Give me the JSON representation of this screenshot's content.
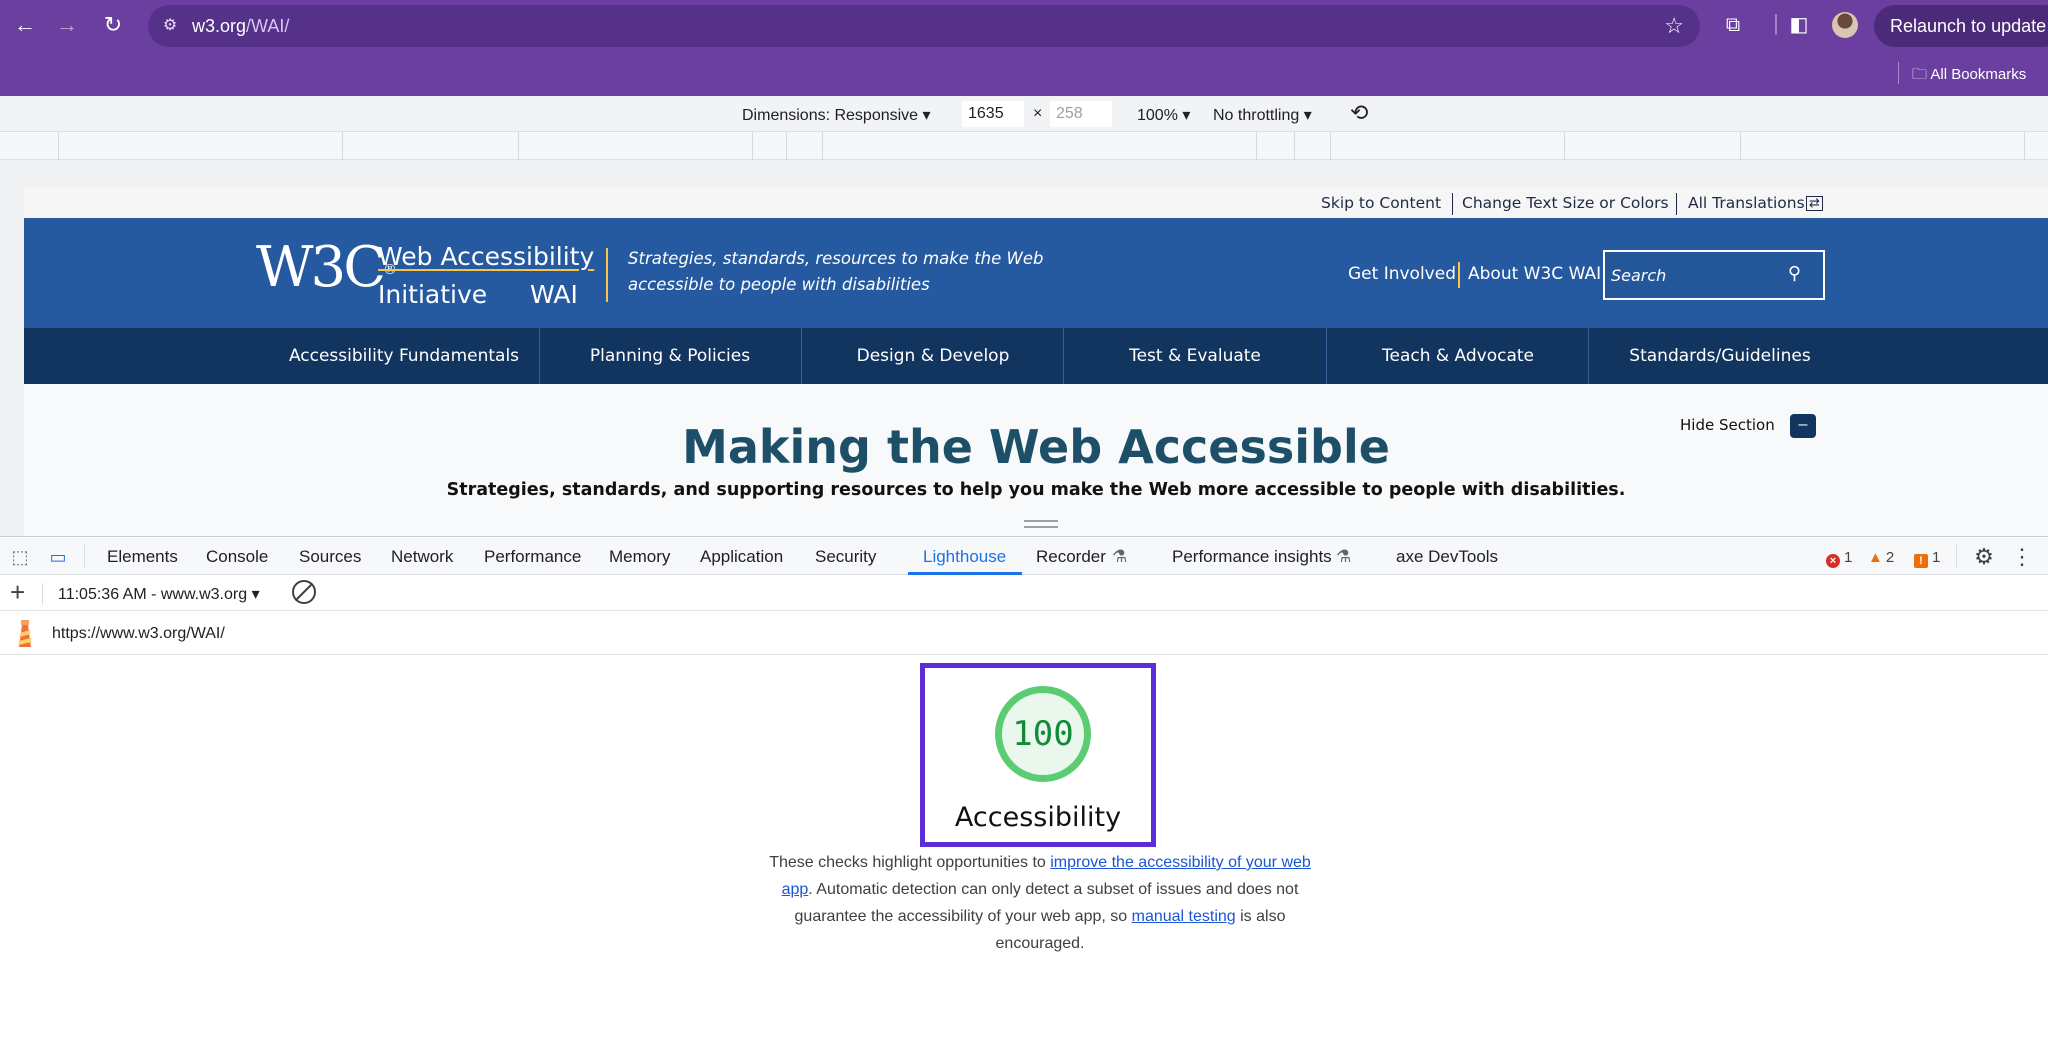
{
  "browser": {
    "url_host": "w3.org",
    "url_path": "/WAI/",
    "relaunch_label": "Relaunch to update",
    "bookmarks_label": "All Bookmarks"
  },
  "device_toolbar": {
    "dimensions_label": "Dimensions: Responsive ▾",
    "width_value": "1635",
    "times": "×",
    "height_placeholder": "258",
    "zoom": "100% ▾",
    "throttling": "No throttling ▾"
  },
  "w3c_page": {
    "skip_links": [
      "Skip to Content",
      "Change Text Size or Colors",
      "All Translations"
    ],
    "logo_text": "W3C",
    "logo_reg": "®",
    "title_line1": "Web Accessibility",
    "title_line2": "Initiative",
    "title_wai": "WAI",
    "tagline": "Strategies, standards, resources to make the Web accessible to people with disabilities",
    "top_links": [
      "Get Involved",
      "About W3C WAI"
    ],
    "search_placeholder": "Search",
    "nav": [
      "Accessibility Fundamentals",
      "Planning & Policies",
      "Design & Develop",
      "Test & Evaluate",
      "Teach & Advocate",
      "Standards/Guidelines"
    ],
    "hide_section": "Hide Section",
    "hide_button": "–",
    "hero_title": "Making the Web Accessible",
    "hero_subtitle": "Strategies, standards, and supporting resources to help you make the Web more accessible to people with disabilities."
  },
  "devtools": {
    "tabs": [
      "Elements",
      "Console",
      "Sources",
      "Network",
      "Performance",
      "Memory",
      "Application",
      "Security",
      "Lighthouse",
      "Recorder",
      "Performance insights",
      "axe DevTools"
    ],
    "active_tab": "Lighthouse",
    "counts": {
      "errors": "1",
      "warnings": "2",
      "issues": "1"
    },
    "report_select": "11:05:36 AM - www.w3.org ▾",
    "lighthouse_url": "https://www.w3.org/WAI/",
    "score": "100",
    "category": "Accessibility",
    "desc_part1": "These checks highlight opportunities to ",
    "desc_link1": "improve the accessibility of your web app",
    "desc_part2": ". Automatic detection can only detect a subset of issues and does not guarantee the accessibility of your web app, so ",
    "desc_link2": "manual testing",
    "desc_part3": " is also encouraged."
  },
  "colors": {
    "chrome_purple": "#6a3fa0",
    "w3c_blue": "#255aa0",
    "w3c_navy": "#12355f",
    "score_green": "#5ccc73",
    "highlight_box": "#5b2ed7",
    "devtools_active": "#1a73e8"
  }
}
